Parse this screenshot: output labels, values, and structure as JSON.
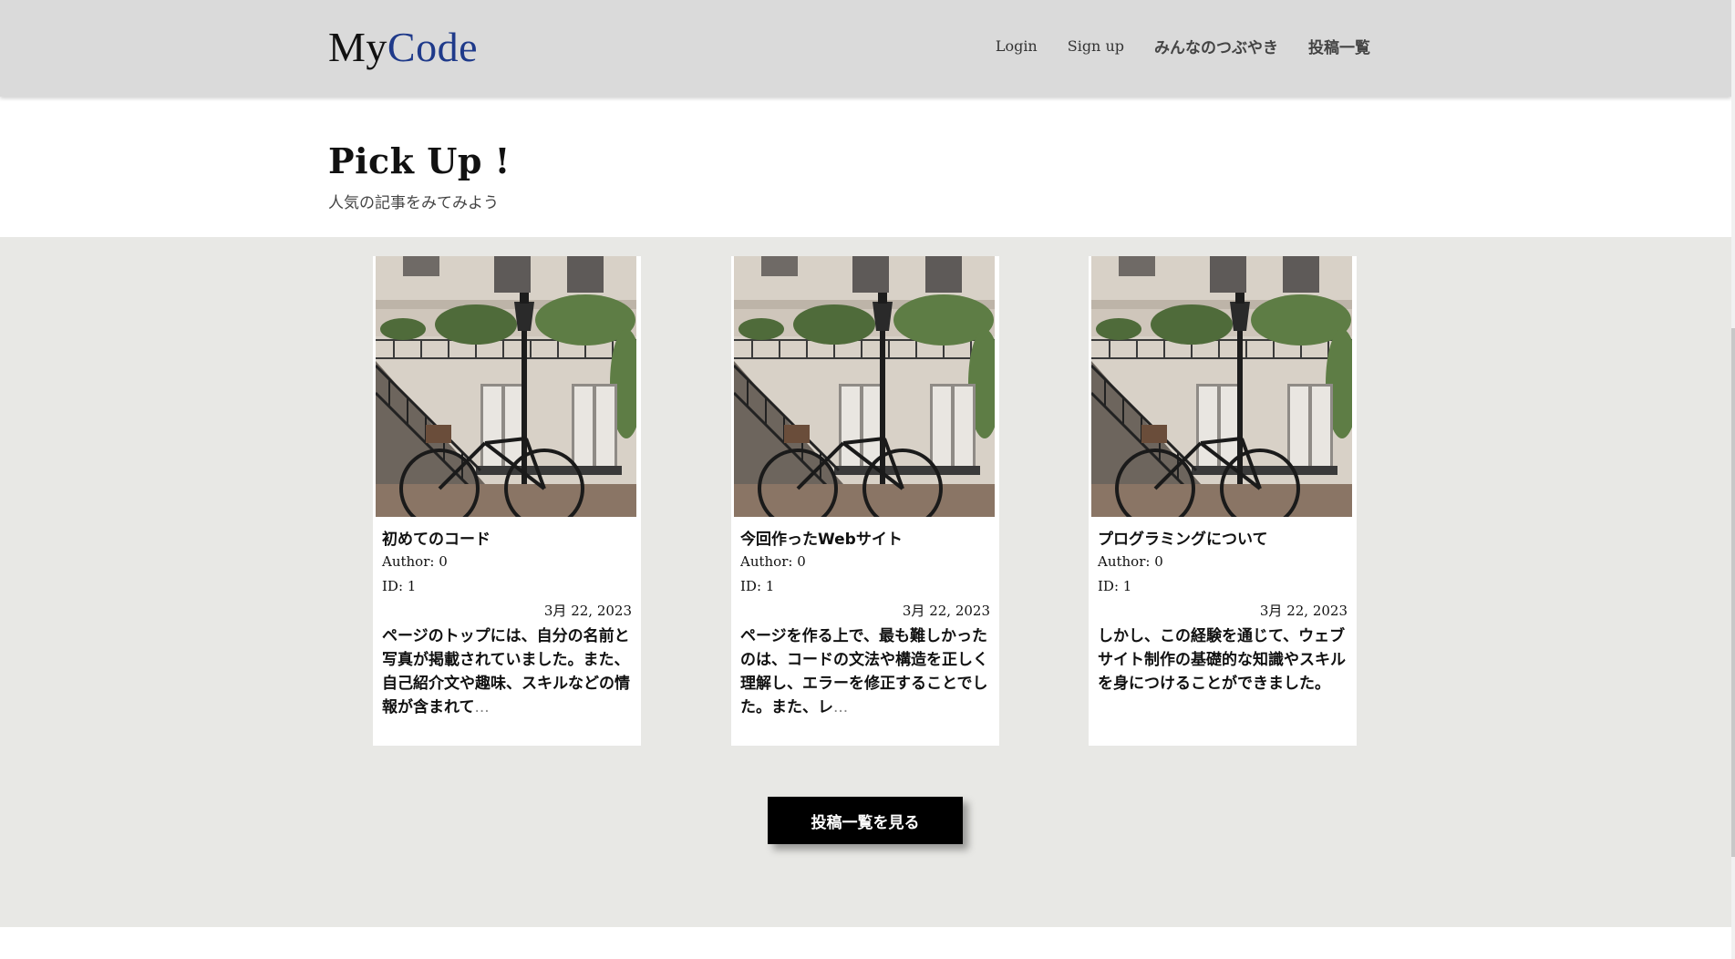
{
  "header": {
    "logo_part1": "My",
    "logo_part2": "Code",
    "nav": [
      "Login",
      "Sign up",
      "みんなのつぶやき",
      "投稿一覧"
    ]
  },
  "pickup": {
    "title": "Pick Up !",
    "subtitle": "人気の記事をみてみよう"
  },
  "cards": [
    {
      "title": "初めてのコード",
      "author": "Author: 0",
      "id": "ID: 1",
      "date": "3月 22, 2023",
      "excerpt": "ページのトップには、自分の名前と写真が掲載されていました。また、自己紹介文や趣味、スキルなどの情報が含まれて",
      "ellipsis": "..."
    },
    {
      "title": "今回作ったWebサイト",
      "author": "Author: 0",
      "id": "ID: 1",
      "date": "3月 22, 2023",
      "excerpt": "ページを作る上で、最も難しかったのは、コードの文法や構造を正しく理解し、エラーを修正することでした。また、レ",
      "ellipsis": "..."
    },
    {
      "title": "プログラミングについて",
      "author": "Author: 0",
      "id": "ID: 1",
      "date": "3月 22, 2023",
      "excerpt": "しかし、この経験を通じて、ウェブサイト制作の基礎的な知識やスキルを身につけることができました。",
      "ellipsis": ""
    }
  ],
  "more_button": "投稿一覧を見る",
  "colors": {
    "header_bg": "#dadada",
    "logo_accent": "#1f3a8a",
    "band_bg": "#e8e8e5",
    "button_bg": "#000000"
  }
}
